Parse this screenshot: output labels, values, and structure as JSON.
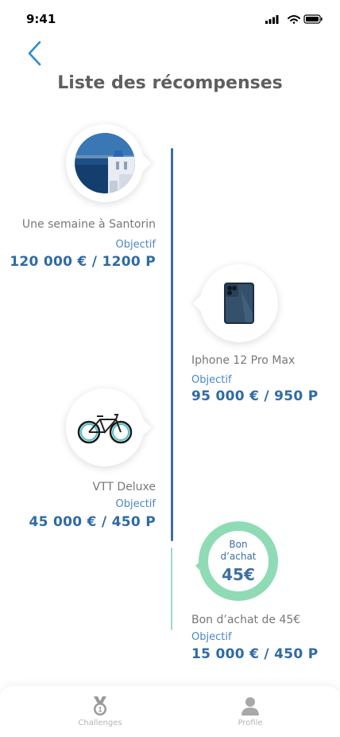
{
  "status": {
    "time": "9:41"
  },
  "header": {
    "title": "Liste des récompenses"
  },
  "rewards": [
    {
      "name": "Une semaine à Santorin",
      "objective_label": "Objectif",
      "value": "120 000 € / 1200 P"
    },
    {
      "name": "Iphone 12 Pro Max",
      "objective_label": "Objectif",
      "value": "95 000 € / 950 P"
    },
    {
      "name": "VTT Deluxe",
      "objective_label": "Objectif",
      "value": "45 000 € / 450 P"
    },
    {
      "name": "Bon d’achat de 45€",
      "objective_label": "Objectif",
      "value": "15 000 € / 450 P",
      "badge": {
        "line1": "Bon",
        "line2": "d’achat",
        "amount": "45€"
      }
    }
  ],
  "nav": {
    "items": [
      {
        "label": "Challenges",
        "icon": "medal-icon"
      },
      {
        "label": "Profile",
        "icon": "user-icon"
      }
    ]
  },
  "colors": {
    "accent": "#2f6aa6",
    "link": "#4a86c8",
    "voucher_ring": "#8fdbb5"
  }
}
